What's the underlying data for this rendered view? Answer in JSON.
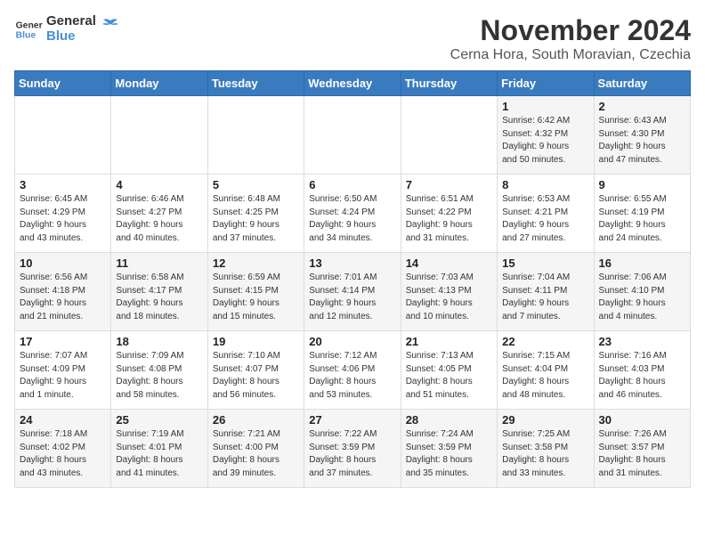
{
  "logo": {
    "line1": "General",
    "line2": "Blue"
  },
  "title": "November 2024",
  "subtitle": "Cerna Hora, South Moravian, Czechia",
  "headers": [
    "Sunday",
    "Monday",
    "Tuesday",
    "Wednesday",
    "Thursday",
    "Friday",
    "Saturday"
  ],
  "weeks": [
    [
      {
        "day": "",
        "info": ""
      },
      {
        "day": "",
        "info": ""
      },
      {
        "day": "",
        "info": ""
      },
      {
        "day": "",
        "info": ""
      },
      {
        "day": "",
        "info": ""
      },
      {
        "day": "1",
        "info": "Sunrise: 6:42 AM\nSunset: 4:32 PM\nDaylight: 9 hours\nand 50 minutes."
      },
      {
        "day": "2",
        "info": "Sunrise: 6:43 AM\nSunset: 4:30 PM\nDaylight: 9 hours\nand 47 minutes."
      }
    ],
    [
      {
        "day": "3",
        "info": "Sunrise: 6:45 AM\nSunset: 4:29 PM\nDaylight: 9 hours\nand 43 minutes."
      },
      {
        "day": "4",
        "info": "Sunrise: 6:46 AM\nSunset: 4:27 PM\nDaylight: 9 hours\nand 40 minutes."
      },
      {
        "day": "5",
        "info": "Sunrise: 6:48 AM\nSunset: 4:25 PM\nDaylight: 9 hours\nand 37 minutes."
      },
      {
        "day": "6",
        "info": "Sunrise: 6:50 AM\nSunset: 4:24 PM\nDaylight: 9 hours\nand 34 minutes."
      },
      {
        "day": "7",
        "info": "Sunrise: 6:51 AM\nSunset: 4:22 PM\nDaylight: 9 hours\nand 31 minutes."
      },
      {
        "day": "8",
        "info": "Sunrise: 6:53 AM\nSunset: 4:21 PM\nDaylight: 9 hours\nand 27 minutes."
      },
      {
        "day": "9",
        "info": "Sunrise: 6:55 AM\nSunset: 4:19 PM\nDaylight: 9 hours\nand 24 minutes."
      }
    ],
    [
      {
        "day": "10",
        "info": "Sunrise: 6:56 AM\nSunset: 4:18 PM\nDaylight: 9 hours\nand 21 minutes."
      },
      {
        "day": "11",
        "info": "Sunrise: 6:58 AM\nSunset: 4:17 PM\nDaylight: 9 hours\nand 18 minutes."
      },
      {
        "day": "12",
        "info": "Sunrise: 6:59 AM\nSunset: 4:15 PM\nDaylight: 9 hours\nand 15 minutes."
      },
      {
        "day": "13",
        "info": "Sunrise: 7:01 AM\nSunset: 4:14 PM\nDaylight: 9 hours\nand 12 minutes."
      },
      {
        "day": "14",
        "info": "Sunrise: 7:03 AM\nSunset: 4:13 PM\nDaylight: 9 hours\nand 10 minutes."
      },
      {
        "day": "15",
        "info": "Sunrise: 7:04 AM\nSunset: 4:11 PM\nDaylight: 9 hours\nand 7 minutes."
      },
      {
        "day": "16",
        "info": "Sunrise: 7:06 AM\nSunset: 4:10 PM\nDaylight: 9 hours\nand 4 minutes."
      }
    ],
    [
      {
        "day": "17",
        "info": "Sunrise: 7:07 AM\nSunset: 4:09 PM\nDaylight: 9 hours\nand 1 minute."
      },
      {
        "day": "18",
        "info": "Sunrise: 7:09 AM\nSunset: 4:08 PM\nDaylight: 8 hours\nand 58 minutes."
      },
      {
        "day": "19",
        "info": "Sunrise: 7:10 AM\nSunset: 4:07 PM\nDaylight: 8 hours\nand 56 minutes."
      },
      {
        "day": "20",
        "info": "Sunrise: 7:12 AM\nSunset: 4:06 PM\nDaylight: 8 hours\nand 53 minutes."
      },
      {
        "day": "21",
        "info": "Sunrise: 7:13 AM\nSunset: 4:05 PM\nDaylight: 8 hours\nand 51 minutes."
      },
      {
        "day": "22",
        "info": "Sunrise: 7:15 AM\nSunset: 4:04 PM\nDaylight: 8 hours\nand 48 minutes."
      },
      {
        "day": "23",
        "info": "Sunrise: 7:16 AM\nSunset: 4:03 PM\nDaylight: 8 hours\nand 46 minutes."
      }
    ],
    [
      {
        "day": "24",
        "info": "Sunrise: 7:18 AM\nSunset: 4:02 PM\nDaylight: 8 hours\nand 43 minutes."
      },
      {
        "day": "25",
        "info": "Sunrise: 7:19 AM\nSunset: 4:01 PM\nDaylight: 8 hours\nand 41 minutes."
      },
      {
        "day": "26",
        "info": "Sunrise: 7:21 AM\nSunset: 4:00 PM\nDaylight: 8 hours\nand 39 minutes."
      },
      {
        "day": "27",
        "info": "Sunrise: 7:22 AM\nSunset: 3:59 PM\nDaylight: 8 hours\nand 37 minutes."
      },
      {
        "day": "28",
        "info": "Sunrise: 7:24 AM\nSunset: 3:59 PM\nDaylight: 8 hours\nand 35 minutes."
      },
      {
        "day": "29",
        "info": "Sunrise: 7:25 AM\nSunset: 3:58 PM\nDaylight: 8 hours\nand 33 minutes."
      },
      {
        "day": "30",
        "info": "Sunrise: 7:26 AM\nSunset: 3:57 PM\nDaylight: 8 hours\nand 31 minutes."
      }
    ]
  ]
}
